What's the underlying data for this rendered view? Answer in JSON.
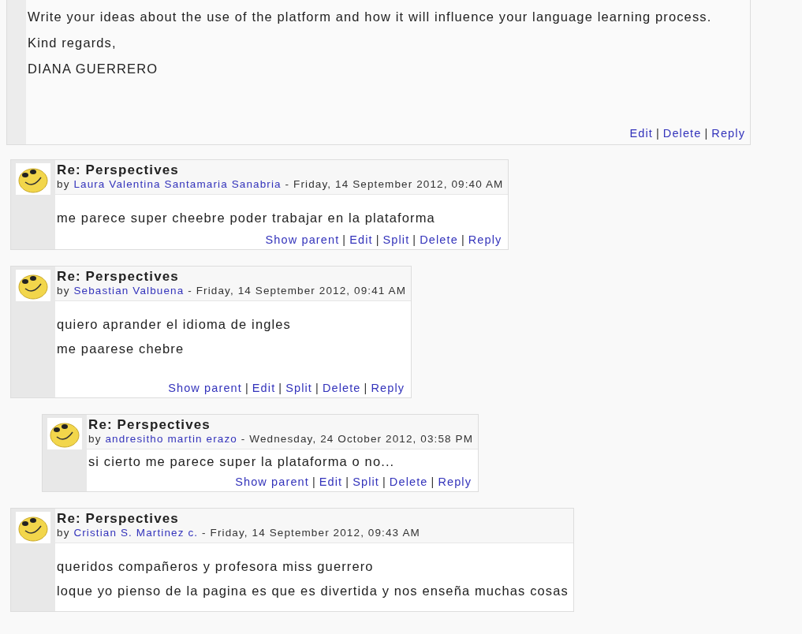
{
  "top_post": {
    "paragraphs": [
      "Write your ideas about the use of the platform and how it will influence your language learning process.",
      "Kind regards,",
      "DIANA GUERRERO"
    ],
    "commands": [
      {
        "kind": "link",
        "label": "Edit"
      },
      {
        "kind": "separator",
        "label": "|"
      },
      {
        "kind": "link",
        "label": "Delete"
      },
      {
        "kind": "separator",
        "label": "|"
      },
      {
        "kind": "link",
        "label": "Reply"
      }
    ]
  },
  "replies": [
    {
      "subject": "Re: Perspectives",
      "by": "by",
      "author": "Laura Valentina Santamaria Sanabria",
      "date": "- Friday, 14 September 2012, 09:40 AM",
      "paragraphs": [
        "me parece super cheebre poder trabajar en la plataforma"
      ],
      "commands": [
        {
          "kind": "link",
          "label": "Show parent"
        },
        {
          "kind": "separator",
          "label": "|"
        },
        {
          "kind": "link",
          "label": "Edit"
        },
        {
          "kind": "separator",
          "label": "|"
        },
        {
          "kind": "link",
          "label": "Split"
        },
        {
          "kind": "separator",
          "label": "|"
        },
        {
          "kind": "link",
          "label": "Delete"
        },
        {
          "kind": "separator",
          "label": "|"
        },
        {
          "kind": "link",
          "label": "Reply"
        }
      ]
    },
    {
      "subject": "Re: Perspectives",
      "by": "by",
      "author": "Sebastian Valbuena",
      "date": "- Friday, 14 September 2012, 09:41 AM",
      "paragraphs": [
        "quiero aprander el idioma de ingles",
        "me paarese chebre"
      ],
      "commands": [
        {
          "kind": "link",
          "label": "Show parent"
        },
        {
          "kind": "separator",
          "label": "|"
        },
        {
          "kind": "link",
          "label": "Edit"
        },
        {
          "kind": "separator",
          "label": "|"
        },
        {
          "kind": "link",
          "label": "Split"
        },
        {
          "kind": "separator",
          "label": "|"
        },
        {
          "kind": "link",
          "label": "Delete"
        },
        {
          "kind": "separator",
          "label": "|"
        },
        {
          "kind": "link",
          "label": "Reply"
        }
      ],
      "children": [
        {
          "subject": "Re: Perspectives",
          "by": "by",
          "author": "andresitho martin erazo",
          "date": "- Wednesday, 24 October 2012, 03:58 PM",
          "paragraphs": [
            "si cierto me parece super la plataforma o no..."
          ],
          "commands": [
            {
              "kind": "link",
              "label": "Show parent"
            },
            {
              "kind": "separator",
              "label": "|"
            },
            {
              "kind": "link",
              "label": "Edit"
            },
            {
              "kind": "separator",
              "label": "|"
            },
            {
              "kind": "link",
              "label": "Split"
            },
            {
              "kind": "separator",
              "label": "|"
            },
            {
              "kind": "link",
              "label": "Delete"
            },
            {
              "kind": "separator",
              "label": "|"
            },
            {
              "kind": "link",
              "label": "Reply"
            }
          ]
        }
      ]
    },
    {
      "subject": "Re: Perspectives",
      "by": "by",
      "author": "Cristian S. Martinez c.",
      "date": "- Friday, 14 September 2012, 09:43 AM",
      "paragraphs": [
        "queridos compañeros y profesora miss guerrero",
        "loque yo pienso de la pagina es que es divertida y nos enseña muchas cosas"
      ]
    }
  ]
}
